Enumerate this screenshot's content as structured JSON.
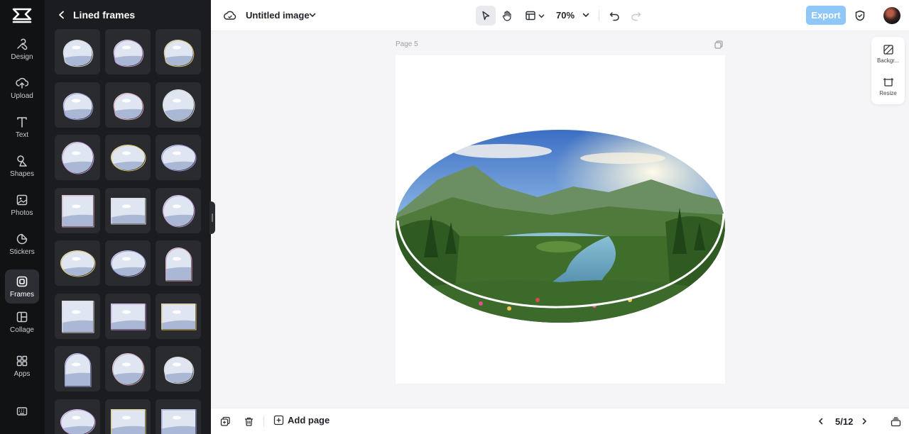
{
  "sidebar": {
    "items": [
      {
        "id": "design",
        "label": "Design",
        "icon": "design-icon",
        "active": false
      },
      {
        "id": "upload",
        "label": "Upload",
        "icon": "upload-icon",
        "active": false
      },
      {
        "id": "text",
        "label": "Text",
        "icon": "text-icon",
        "active": false
      },
      {
        "id": "shapes",
        "label": "Shapes",
        "icon": "shapes-icon",
        "active": false
      },
      {
        "id": "photos",
        "label": "Photos",
        "icon": "photos-icon",
        "active": false
      },
      {
        "id": "stickers",
        "label": "Stickers",
        "icon": "stickers-icon",
        "active": false
      },
      {
        "id": "frames",
        "label": "Frames",
        "icon": "frames-icon",
        "active": true
      },
      {
        "id": "collage",
        "label": "Collage",
        "icon": "collage-icon",
        "active": false
      },
      {
        "id": "apps",
        "label": "Apps",
        "icon": "apps-icon",
        "active": false
      }
    ],
    "bottom_icon": "keyboard-icon"
  },
  "panel": {
    "title": "Lined frames",
    "back_icon": "chevron-left-icon",
    "frames": [
      "blob-frame",
      "blob-frame",
      "blob-frame",
      "blob-frame",
      "blob-frame",
      "circle-frame",
      "circle-frame",
      "ellipse-frame",
      "ellipse-frame",
      "square-frame",
      "rectangle-frame",
      "circle-frame",
      "ellipse-frame",
      "ellipse-frame",
      "arch-frame",
      "square-frame",
      "rectangle-frame",
      "rectangle-frame",
      "arch-frame",
      "circle-frame",
      "blob-frame",
      "ellipse-frame",
      "rectangle-frame",
      "rectangle-frame"
    ]
  },
  "topbar": {
    "cloud_icon": "cloud-icon",
    "document_title": "Untitled image",
    "zoom_level": "70%",
    "export_label": "Export",
    "tools": [
      "select-icon",
      "hand-icon",
      "layout-icon"
    ],
    "shield_icon": "shield-icon"
  },
  "canvas": {
    "page_label": "Page 5"
  },
  "side_tools": [
    {
      "label": "Backgr...",
      "icon": "background-icon"
    },
    {
      "label": "Resize",
      "icon": "resize-icon"
    }
  ],
  "bottombar": {
    "add_page_label": "Add page",
    "page_count": "5/12"
  },
  "colors": {
    "rail_bg": "#111214",
    "panel_bg": "#1b1c1f",
    "tile_bg": "#2a2b2f",
    "export_bg": "#8fc8f8",
    "canvas_bg": "#f5f5f7"
  }
}
